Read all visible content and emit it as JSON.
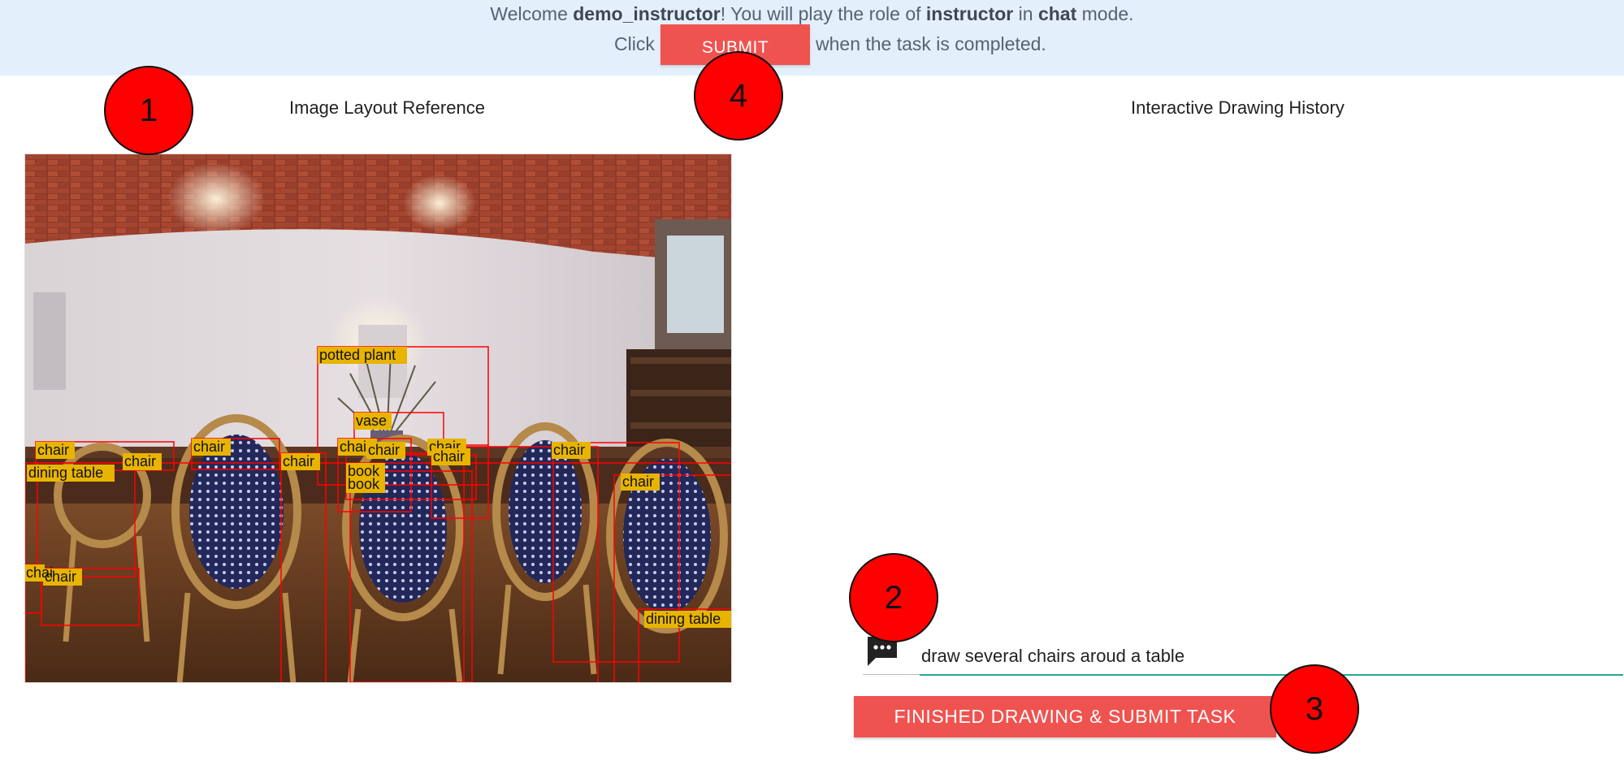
{
  "banner": {
    "welcome_prefix": "Welcome ",
    "username": "demo_instructor",
    "role_text": "! You will play the role of ",
    "role": "instructor",
    "mode_prefix": " in ",
    "mode": "chat",
    "mode_suffix": " mode.",
    "click_text": "Click",
    "submit_label": "SUBMIT",
    "after_submit_text": "when the task is completed.",
    "background_color": "#e3f0fb"
  },
  "left_panel": {
    "heading": "Image Layout Reference"
  },
  "right_panel": {
    "heading": "Interactive Drawing History"
  },
  "reference_image": {
    "description_icon": "photo",
    "box_color": "#ff0000",
    "label_bg": "#e8b400",
    "labels": [
      "potted plant",
      "vase",
      "chair",
      "chair",
      "dining table",
      "chair",
      "chair",
      "chair",
      "book",
      "book",
      "chair",
      "chair",
      "chair",
      "chair",
      "chair",
      "chai",
      "chair",
      "dining table"
    ]
  },
  "chat": {
    "icon": "chat-bubble-icon",
    "input_value": "draw several chairs aroud a table",
    "accent_color": "#26a69a"
  },
  "actions": {
    "finished_label": "FINISHED DRAWING & SUBMIT TASK",
    "button_color": "#ef5350"
  },
  "markers": {
    "m1": "1",
    "m2": "2",
    "m3": "3",
    "m4": "4"
  }
}
